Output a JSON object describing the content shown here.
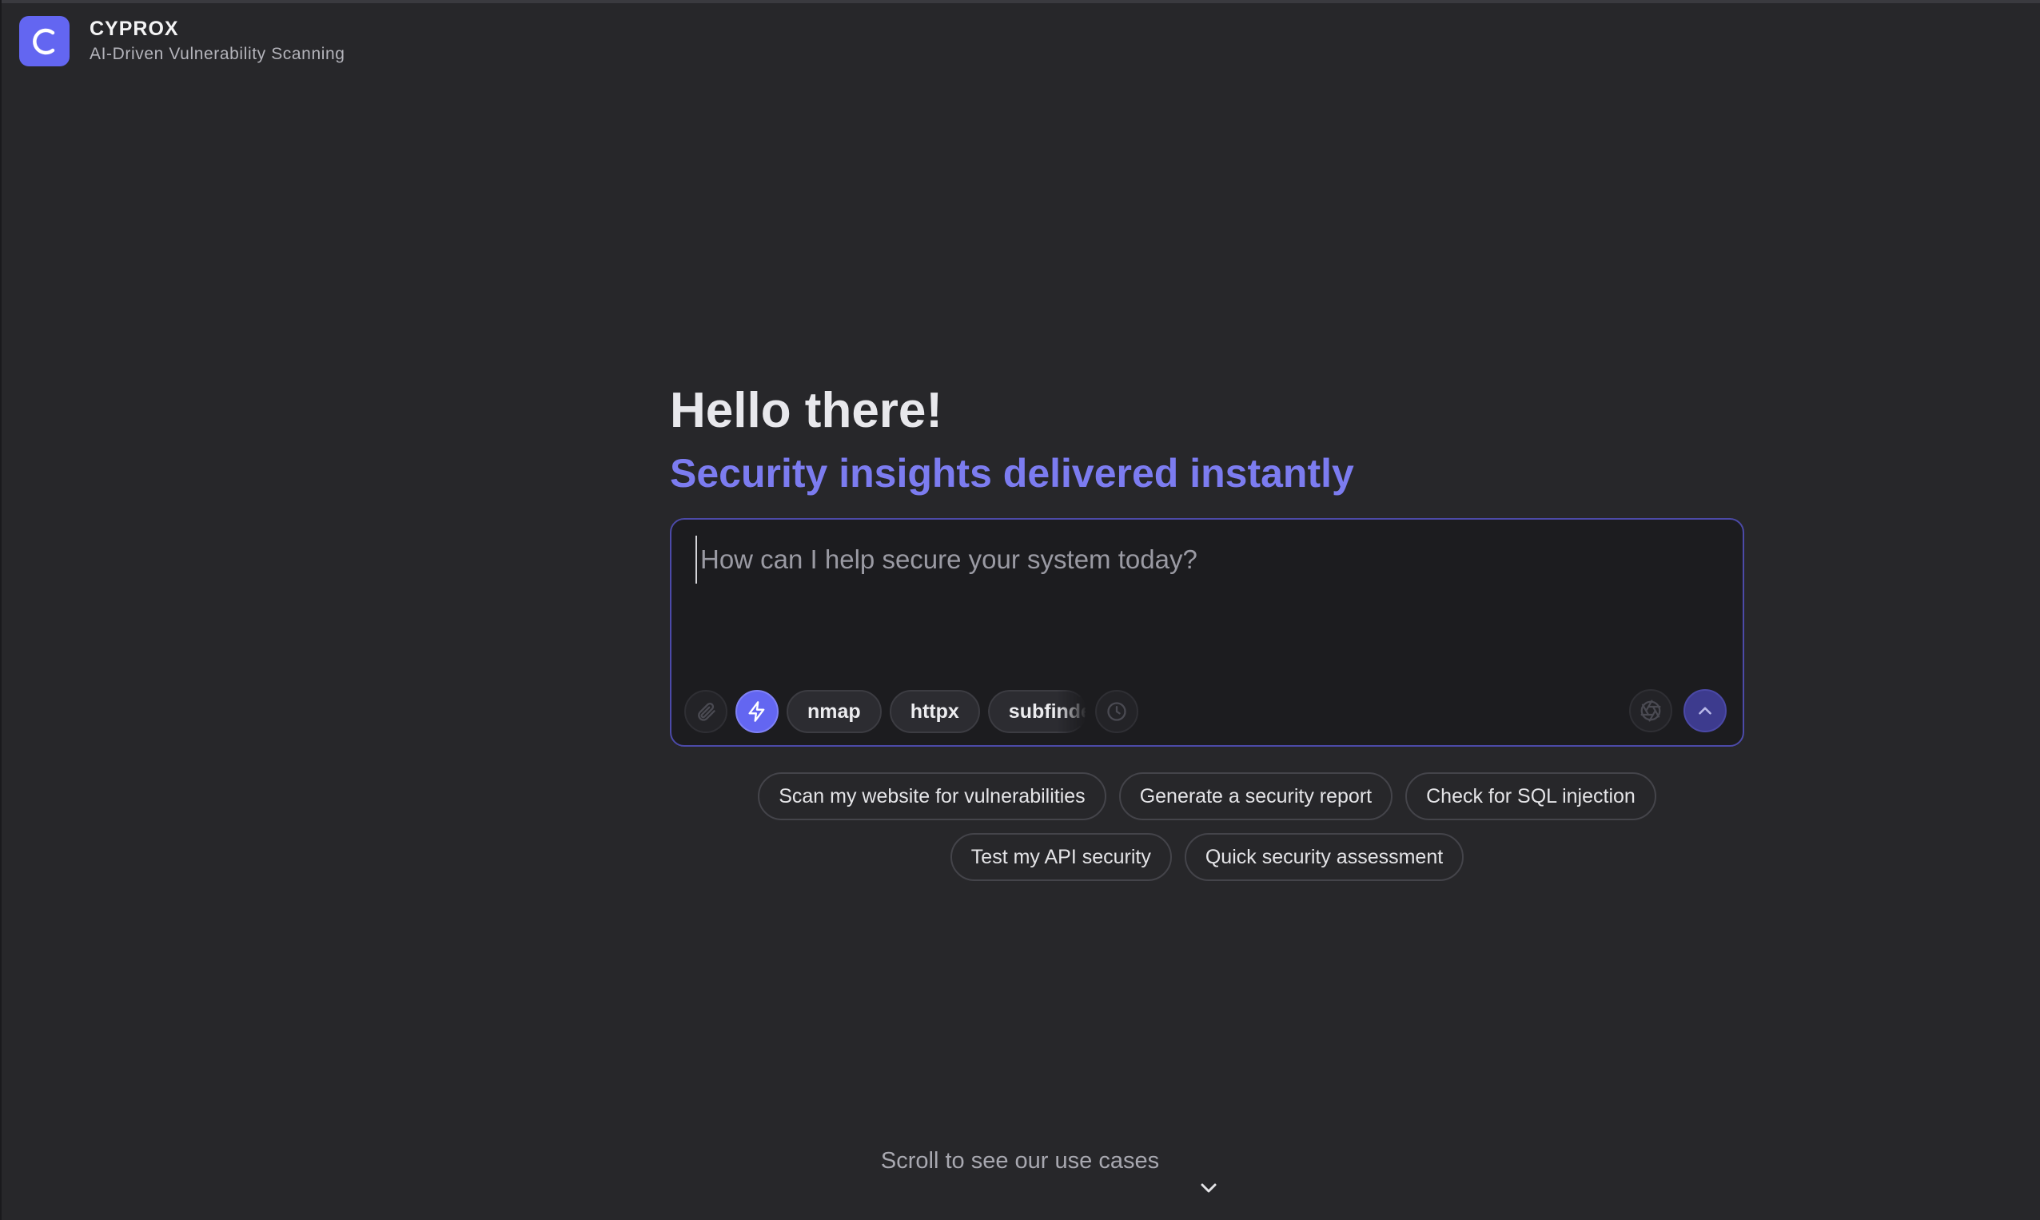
{
  "brand": {
    "name": "CYPROX",
    "tagline": "AI-Driven Vulnerability Scanning",
    "logo_icon": "c-logo-icon"
  },
  "hero": {
    "title": "Hello there!",
    "subtitle": "Security insights delivered instantly"
  },
  "prompt": {
    "placeholder": "How can I help secure your system today?",
    "value": "",
    "tools": {
      "attach_icon": "paperclip-icon",
      "quick_mode_icon": "lightning-icon",
      "chips": [
        "nmap",
        "httpx",
        "subfinder"
      ],
      "history_icon": "clock-icon",
      "settings_icon": "aperture-icon",
      "send_icon": "chevron-up-icon"
    }
  },
  "suggestions": [
    "Scan my website for vulnerabilities",
    "Generate a security report",
    "Check for SQL injection",
    "Test my API security",
    "Quick security assessment"
  ],
  "scroll_hint": "Scroll to see our use cases",
  "colors": {
    "background": "#27272a",
    "accent": "#6366f1",
    "accent_text": "#7c7cf0",
    "input_bg": "#1c1c1f"
  }
}
